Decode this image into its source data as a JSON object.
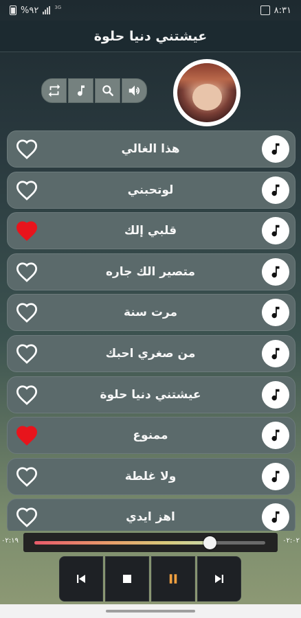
{
  "status_bar": {
    "time": "٨:٣١",
    "battery": "%٩٢",
    "network": "3G"
  },
  "title": "عيشتني دنيا حلوة",
  "toolbar": {
    "icons": [
      "volume-icon",
      "search-icon",
      "music-note-icon",
      "repeat-icon"
    ]
  },
  "songs": [
    {
      "title": "هذا الغالي",
      "favorite": false
    },
    {
      "title": "لوتحبني",
      "favorite": false
    },
    {
      "title": "قلبي إلك",
      "favorite": true
    },
    {
      "title": "متصير الك جاره",
      "favorite": false
    },
    {
      "title": "مرت سنة",
      "favorite": false
    },
    {
      "title": "من صغري احبك",
      "favorite": false
    },
    {
      "title": "عيشتني دنيا حلوة",
      "favorite": false
    },
    {
      "title": "ممنوع",
      "favorite": true
    },
    {
      "title": "ولا غلطة",
      "favorite": false
    },
    {
      "title": "اهز ايدي",
      "favorite": false
    }
  ],
  "player": {
    "elapsed": "٠٢:١٩",
    "duration": "٠٢:٠٢",
    "progress": 0.76,
    "controls": [
      "previous-icon",
      "stop-icon",
      "pause-icon",
      "next-icon"
    ]
  },
  "colors": {
    "heart_filled": "#e8141c",
    "pause_accent": "#f0a040"
  }
}
